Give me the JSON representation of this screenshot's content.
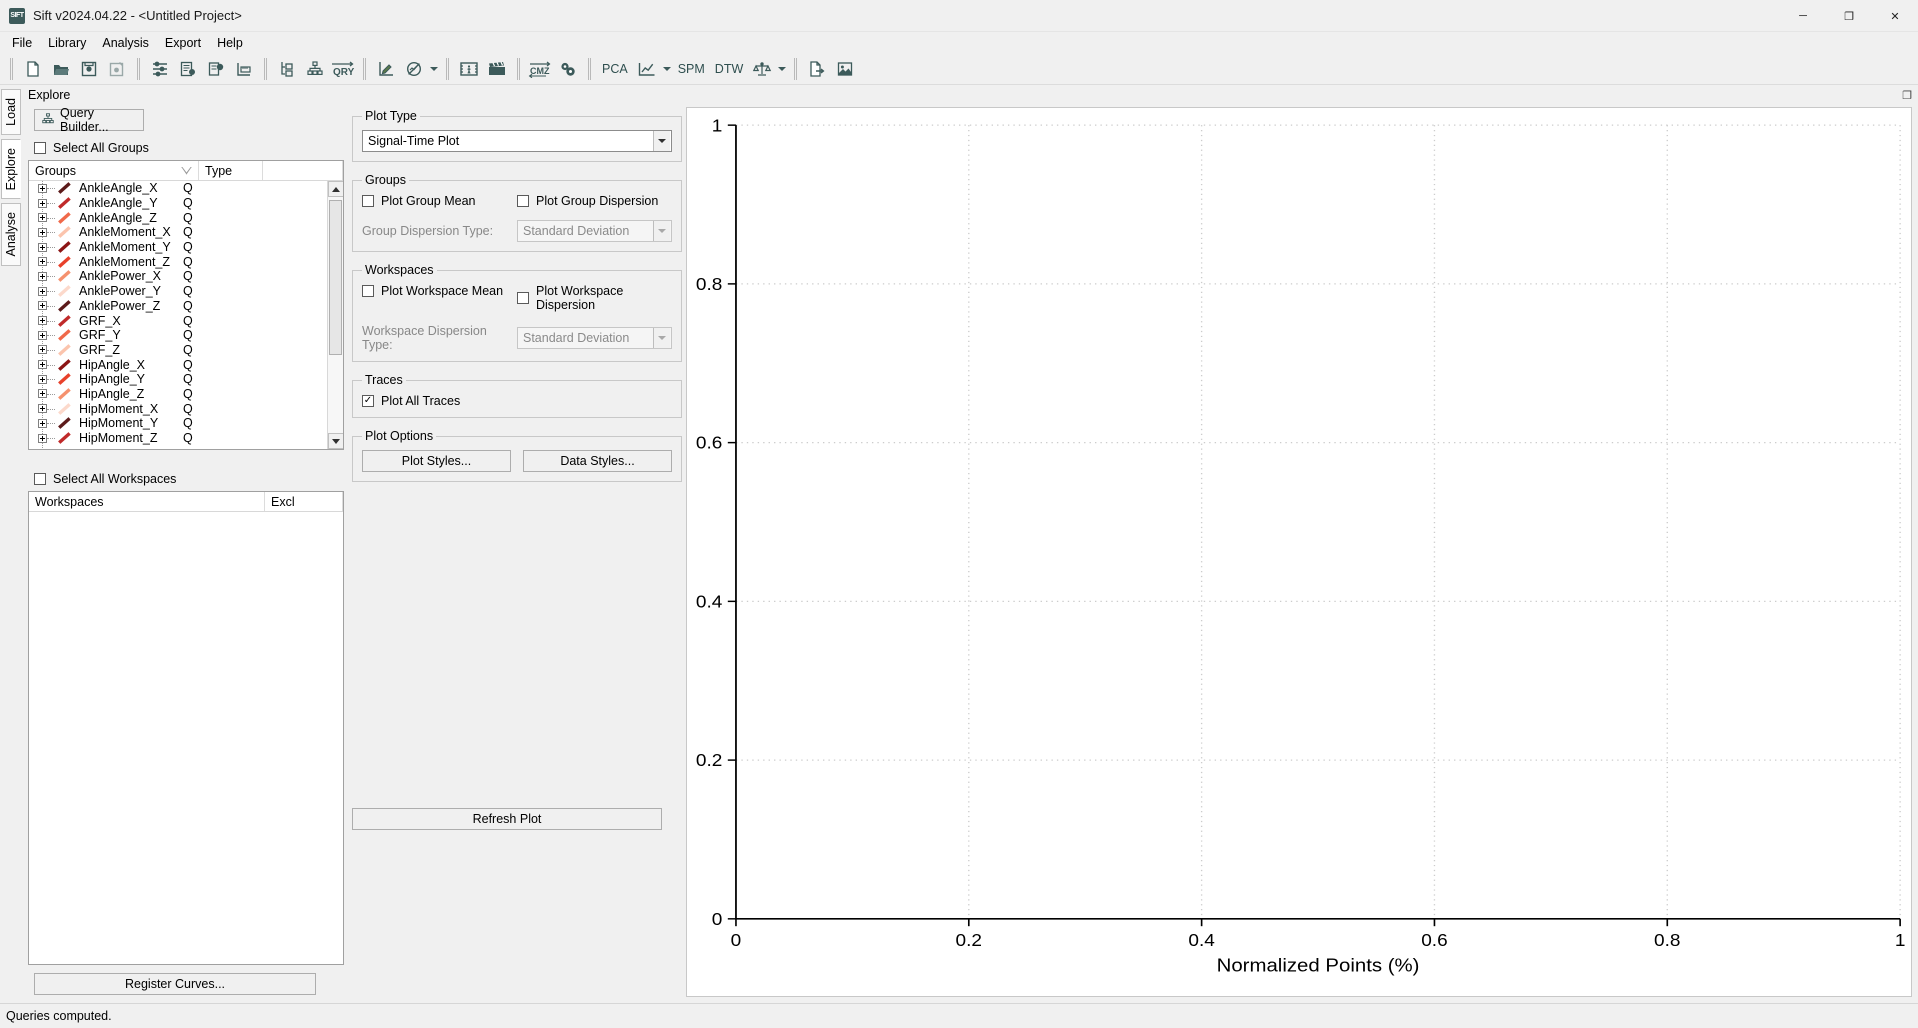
{
  "window": {
    "title": "Sift v2024.04.22 - <Untitled Project>",
    "app_icon": "SIFT",
    "minimize": "─",
    "maximize": "❐",
    "close": "✕"
  },
  "menubar": [
    {
      "label": "File"
    },
    {
      "label": "Library"
    },
    {
      "label": "Analysis"
    },
    {
      "label": "Export"
    },
    {
      "label": "Help"
    }
  ],
  "toolbar": {
    "groups": [
      {
        "items": [
          {
            "icon": "new-document-icon",
            "label": ""
          },
          {
            "icon": "open-folder-icon",
            "label": ""
          },
          {
            "icon": "save-icon",
            "label": ""
          },
          {
            "icon": "save-as-icon",
            "label": ""
          }
        ]
      },
      {
        "items": [
          {
            "icon": "sliders-icon",
            "label": ""
          },
          {
            "icon": "document-settings-icon",
            "label": ""
          },
          {
            "icon": "gear-settings-icon",
            "label": ""
          },
          {
            "icon": "ruler-icon",
            "label": ""
          }
        ]
      },
      {
        "items": [
          {
            "icon": "tree-structure-icon",
            "label": ""
          },
          {
            "icon": "hierarchy-icon",
            "label": ""
          },
          {
            "icon": "qry-icon",
            "label": ""
          }
        ]
      },
      {
        "items": [
          {
            "icon": "edit-pen-icon",
            "label": ""
          },
          {
            "icon": "signal-no-icon",
            "label": "",
            "dropdown": true
          }
        ]
      },
      {
        "items": [
          {
            "icon": "film-person-icon",
            "label": ""
          },
          {
            "icon": "clapperboard-icon",
            "label": ""
          }
        ]
      },
      {
        "items": [
          {
            "icon": "cmz-icon",
            "label": ""
          },
          {
            "icon": "gears-icon",
            "label": ""
          }
        ]
      },
      {
        "items": [
          {
            "icon": "pca-text-icon",
            "label": "PCA"
          },
          {
            "icon": "chart-line-icon",
            "label": "",
            "dropdown": true
          },
          {
            "icon": "spm-text-icon",
            "label": "SPM"
          },
          {
            "icon": "dtw-text-icon",
            "label": "DTW"
          },
          {
            "icon": "scales-icon",
            "label": "",
            "dropdown": true
          }
        ]
      },
      {
        "items": [
          {
            "icon": "export-file-icon",
            "label": ""
          },
          {
            "icon": "export-image-icon",
            "label": ""
          }
        ]
      }
    ]
  },
  "sidebar": {
    "tabs": [
      {
        "label": "Load",
        "active": false
      },
      {
        "label": "Explore",
        "active": true
      },
      {
        "label": "Analyse",
        "active": false
      }
    ]
  },
  "explore": {
    "header": "Explore",
    "dock_icon": "❐",
    "query_builder_label": "Query Builder...",
    "query_builder_icon": "hierarchy-icon",
    "select_all_groups": {
      "label": "Select All Groups",
      "checked": false
    },
    "select_all_workspaces": {
      "label": "Select All Workspaces",
      "checked": false
    },
    "groups_table": {
      "columns": [
        "Groups",
        "Type",
        ""
      ],
      "sort_indicator": "sort-descending-icon",
      "rows": [
        {
          "name": "AnkleAngle_X",
          "type": "Q",
          "color": "#5c1a1a"
        },
        {
          "name": "AnkleAngle_Y",
          "type": "Q",
          "color": "#c02a2a"
        },
        {
          "name": "AnkleAngle_Z",
          "type": "Q",
          "color": "#f0694a"
        },
        {
          "name": "AnkleMoment_X",
          "type": "Q",
          "color": "#fbc4ad"
        },
        {
          "name": "AnkleMoment_Y",
          "type": "Q",
          "color": "#8c1515"
        },
        {
          "name": "AnkleMoment_Z",
          "type": "Q",
          "color": "#e8412b"
        },
        {
          "name": "AnklePower_X",
          "type": "Q",
          "color": "#f5916e"
        },
        {
          "name": "AnklePower_Y",
          "type": "Q",
          "color": "#fcd9cb"
        },
        {
          "name": "AnklePower_Z",
          "type": "Q",
          "color": "#5c1a1a"
        },
        {
          "name": "GRF_X",
          "type": "Q",
          "color": "#c02a2a"
        },
        {
          "name": "GRF_Y",
          "type": "Q",
          "color": "#f0694a"
        },
        {
          "name": "GRF_Z",
          "type": "Q",
          "color": "#fbc4ad"
        },
        {
          "name": "HipAngle_X",
          "type": "Q",
          "color": "#8c1515"
        },
        {
          "name": "HipAngle_Y",
          "type": "Q",
          "color": "#e8412b"
        },
        {
          "name": "HipAngle_Z",
          "type": "Q",
          "color": "#f5916e"
        },
        {
          "name": "HipMoment_X",
          "type": "Q",
          "color": "#fcd9cb"
        },
        {
          "name": "HipMoment_Y",
          "type": "Q",
          "color": "#5c1a1a"
        },
        {
          "name": "HipMoment_Z",
          "type": "Q",
          "color": "#c02a2a"
        }
      ]
    },
    "workspaces_table": {
      "columns": [
        "Workspaces",
        "Excl"
      ],
      "rows": []
    },
    "register_curves_label": "Register Curves...",
    "refresh_plot_label": "Refresh Plot"
  },
  "plot_settings": {
    "plot_type": {
      "legend": "Plot Type",
      "value": "Signal-Time Plot"
    },
    "groups": {
      "legend": "Groups",
      "plot_group_mean": {
        "label": "Plot Group Mean",
        "checked": false
      },
      "plot_group_dispersion": {
        "label": "Plot Group Dispersion",
        "checked": false
      },
      "dispersion_type_label": "Group Dispersion Type:",
      "dispersion_type_value": "Standard Deviation"
    },
    "workspaces": {
      "legend": "Workspaces",
      "plot_workspace_mean": {
        "label": "Plot Workspace Mean",
        "checked": false
      },
      "plot_workspace_dispersion": {
        "label": "Plot Workspace Dispersion",
        "checked": false
      },
      "dispersion_type_label": "Workspace Dispersion Type:",
      "dispersion_type_value": "Standard Deviation"
    },
    "traces": {
      "legend": "Traces",
      "plot_all_traces": {
        "label": "Plot All Traces",
        "checked": true
      }
    },
    "plot_options": {
      "legend": "Plot Options",
      "plot_styles_label": "Plot Styles...",
      "data_styles_label": "Data Styles..."
    }
  },
  "chart_data": {
    "type": "line",
    "title": "",
    "xlabel": "Normalized Points (%)",
    "ylabel": "",
    "x_ticks": [
      "0",
      "0.2",
      "0.4",
      "0.6",
      "0.8",
      "1"
    ],
    "x_tick_values": [
      0,
      0.2,
      0.4,
      0.6,
      0.8,
      1
    ],
    "y_ticks": [
      "0",
      "0.2",
      "0.4",
      "0.6",
      "0.8",
      "1"
    ],
    "y_tick_values": [
      0,
      0.2,
      0.4,
      0.6,
      0.8,
      1
    ],
    "xlim": [
      0,
      1
    ],
    "ylim": [
      0,
      1
    ],
    "grid": true,
    "grid_style": "dotted",
    "legend": "none",
    "series": []
  },
  "statusbar": {
    "message": "Queries computed."
  }
}
